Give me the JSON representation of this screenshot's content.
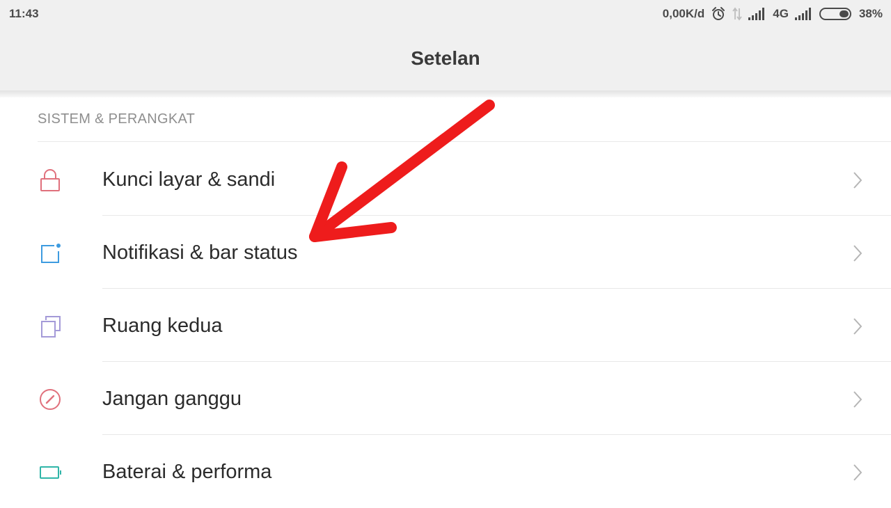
{
  "status_bar": {
    "time": "11:43",
    "net_speed": "0,00K/d",
    "network_type": "4G",
    "battery_percent": "38%",
    "battery_level": 0.38,
    "icons": [
      "alarm-icon",
      "data-transfer-icon",
      "signal-icon",
      "signal-icon",
      "battery-icon"
    ]
  },
  "header": {
    "title": "Setelan"
  },
  "section": {
    "title": "SISTEM & PERANGKAT"
  },
  "items": [
    {
      "label": "Kunci layar & sandi",
      "icon": "lock-icon",
      "icon_color": "#e0707c"
    },
    {
      "label": "Notifikasi & bar status",
      "icon": "notification-icon",
      "icon_color": "#3d9be0"
    },
    {
      "label": "Ruang kedua",
      "icon": "second-space-icon",
      "icon_color": "#a49ad8"
    },
    {
      "label": "Jangan ganggu",
      "icon": "do-not-disturb-icon",
      "icon_color": "#e0707c"
    },
    {
      "label": "Baterai & performa",
      "icon": "battery-performance-icon",
      "icon_color": "#2fb5a8"
    }
  ],
  "annotation": {
    "arrow_color": "#ee1c1c"
  }
}
